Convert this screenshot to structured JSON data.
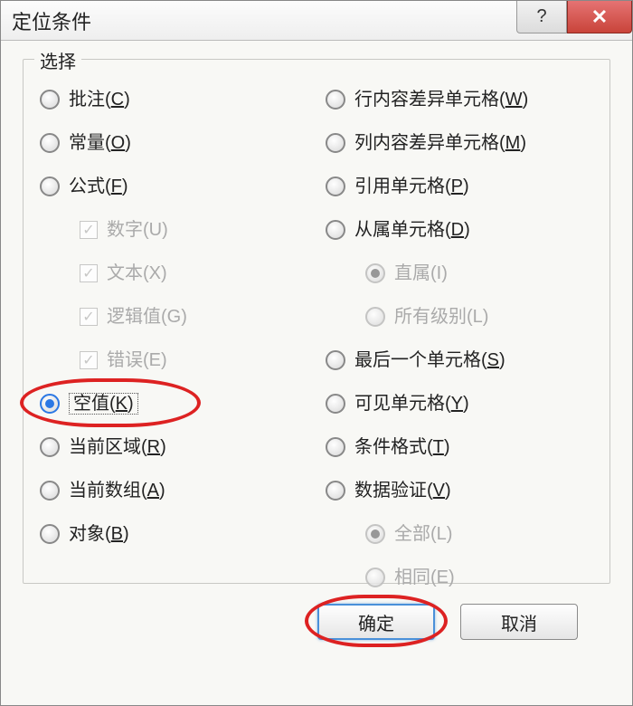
{
  "window": {
    "title": "定位条件",
    "help_symbol": "?",
    "close_symbol": "✕"
  },
  "fieldset_legend": "选择",
  "left": {
    "comments": "批注(C)",
    "constants": "常量(O)",
    "formulas": "公式(F)",
    "numbers": "数字(U)",
    "text": "文本(X)",
    "logicals": "逻辑值(G)",
    "errors": "错误(E)",
    "blanks": "空值(K)",
    "current_region": "当前区域(R)",
    "current_array": "当前数组(A)",
    "objects": "对象(B)"
  },
  "right": {
    "row_diff": "行内容差异单元格(W)",
    "col_diff": "列内容差异单元格(M)",
    "precedents": "引用单元格(P)",
    "dependents": "从属单元格(D)",
    "direct_only": "直属(I)",
    "all_levels": "所有级别(L)",
    "last_cell": "最后一个单元格(S)",
    "visible_cells": "可见单元格(Y)",
    "cond_fmt": "条件格式(T)",
    "data_valid": "数据验证(V)",
    "all": "全部(L)",
    "same": "相同(E)"
  },
  "buttons": {
    "ok": "确定",
    "cancel": "取消"
  }
}
